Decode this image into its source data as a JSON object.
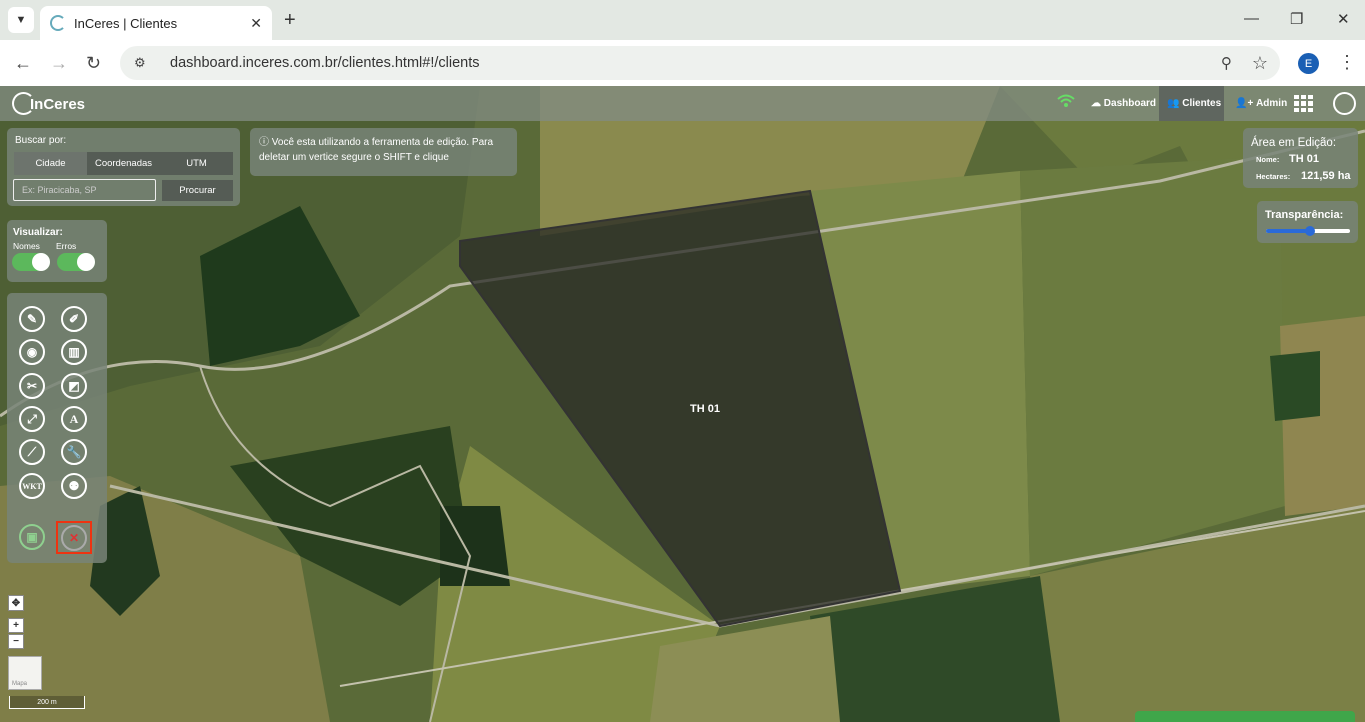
{
  "browser": {
    "tab_title": "InCeres | Clientes",
    "url": "dashboard.inceres.com.br/clientes.html#!/clients",
    "profile_initial": "E"
  },
  "app": {
    "logo": "InCeres",
    "nav": {
      "dashboard": "Dashboard",
      "clientes": "Clientes",
      "admin": "Admin"
    }
  },
  "search": {
    "label": "Buscar por:",
    "tabs": [
      "Cidade",
      "Coordenadas",
      "UTM"
    ],
    "placeholder": "Ex: Piracicaba, SP",
    "button": "Procurar"
  },
  "tip": "ⓘ Você esta utilizando a ferramenta de edição. Para deletar um vertice segure o SHIFT e clique",
  "visualizar": {
    "title": "Visualizar:",
    "nomes": "Nomes",
    "erros": "Erros"
  },
  "area": {
    "title": "Área em Edição:",
    "nome_label": "Nome:",
    "nome": "TH 01",
    "hectares_label": "Hectares:",
    "hectares": "121,59 ha"
  },
  "transparencia": {
    "label": "Transparência:",
    "value_pct": 52
  },
  "field_label": "TH 01",
  "map": {
    "basemap_label": "Mapa",
    "scale": "200 m"
  },
  "tools": [
    "pencil-icon",
    "edit-icon",
    "bucket-icon",
    "trash-icon",
    "cut-icon",
    "reshape-icon",
    "expand-icon",
    "A",
    "ruler-icon",
    "wrench-icon",
    "WKT",
    "merge-icon",
    "save-icon",
    "cancel-icon"
  ]
}
